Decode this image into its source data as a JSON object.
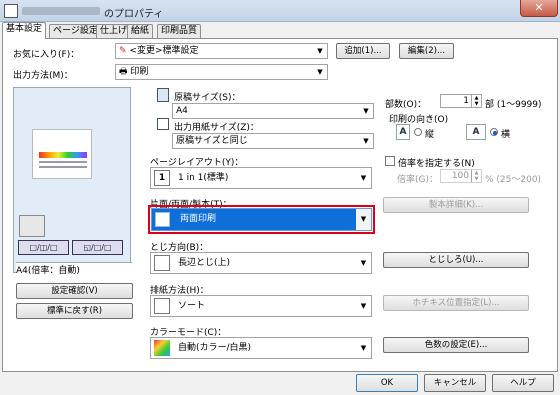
{
  "window": {
    "title": "のプロパティ",
    "close_glyph": "✕"
  },
  "tabs": [
    {
      "label": "基本設定",
      "active": true
    },
    {
      "label": "ページ設定",
      "active": false
    },
    {
      "label": "仕上げ",
      "active": false
    },
    {
      "label": "給紙",
      "active": false
    },
    {
      "label": "印刷品質",
      "active": false
    }
  ],
  "favorites": {
    "label": "お気に入り(F)：",
    "value": "<変更>標準設定",
    "add_button": "追加(1)...",
    "edit_button": "編集(2)..."
  },
  "output_method": {
    "label": "出力方法(M)：",
    "value": "印刷"
  },
  "original_size": {
    "label": "原稿サイズ(S)：",
    "value": "A4"
  },
  "output_paper_size": {
    "label": "出力用紙サイズ(Z)：",
    "value": "原稿サイズと同じ"
  },
  "copies": {
    "label": "部数(O)：",
    "value": "1",
    "range": "部 (1〜9999)"
  },
  "orientation": {
    "label": "印刷の向き(O)",
    "portrait_label": "縦",
    "landscape_label": "横",
    "selected": "landscape",
    "portrait_glyph": "A",
    "landscape_glyph": "A"
  },
  "page_layout": {
    "label": "ページレイアウト(Y)：",
    "value": "1 in 1(標準)",
    "badge": "1"
  },
  "scale": {
    "checkbox_label": "倍率を指定する(N)",
    "rate_label": "倍率(G)：",
    "value": "100",
    "range": "% (25〜200)"
  },
  "duplex": {
    "label": "片面/両面/製本(T)：",
    "value": "両面印刷"
  },
  "booklet_detail_button": "製本詳細(K)...",
  "binding": {
    "label": "とじ方向(B)：",
    "value": "長辺とじ(上)"
  },
  "margin_button": "とじしろ(U)...",
  "output_tray": {
    "label": "排紙方法(H)：",
    "value": "ソート"
  },
  "staple_button": "ホチキス位置指定(L)...",
  "color_mode": {
    "label": "カラーモード(C)：",
    "value": "自動(カラー/白黒)"
  },
  "color_settings_button": "色数の設定(E)...",
  "preview": {
    "status": "A4(倍率：自動)"
  },
  "left_buttons": {
    "confirm": "設定確認(V)",
    "restore": "標準に戻す(R)"
  },
  "footer": {
    "ok": "OK",
    "cancel": "キャンセル",
    "help": "ヘルプ"
  },
  "colors": {
    "selection": "#0f6fd8",
    "highlight_border": "#d9001b",
    "preview_bg": "#e2ecf8"
  }
}
